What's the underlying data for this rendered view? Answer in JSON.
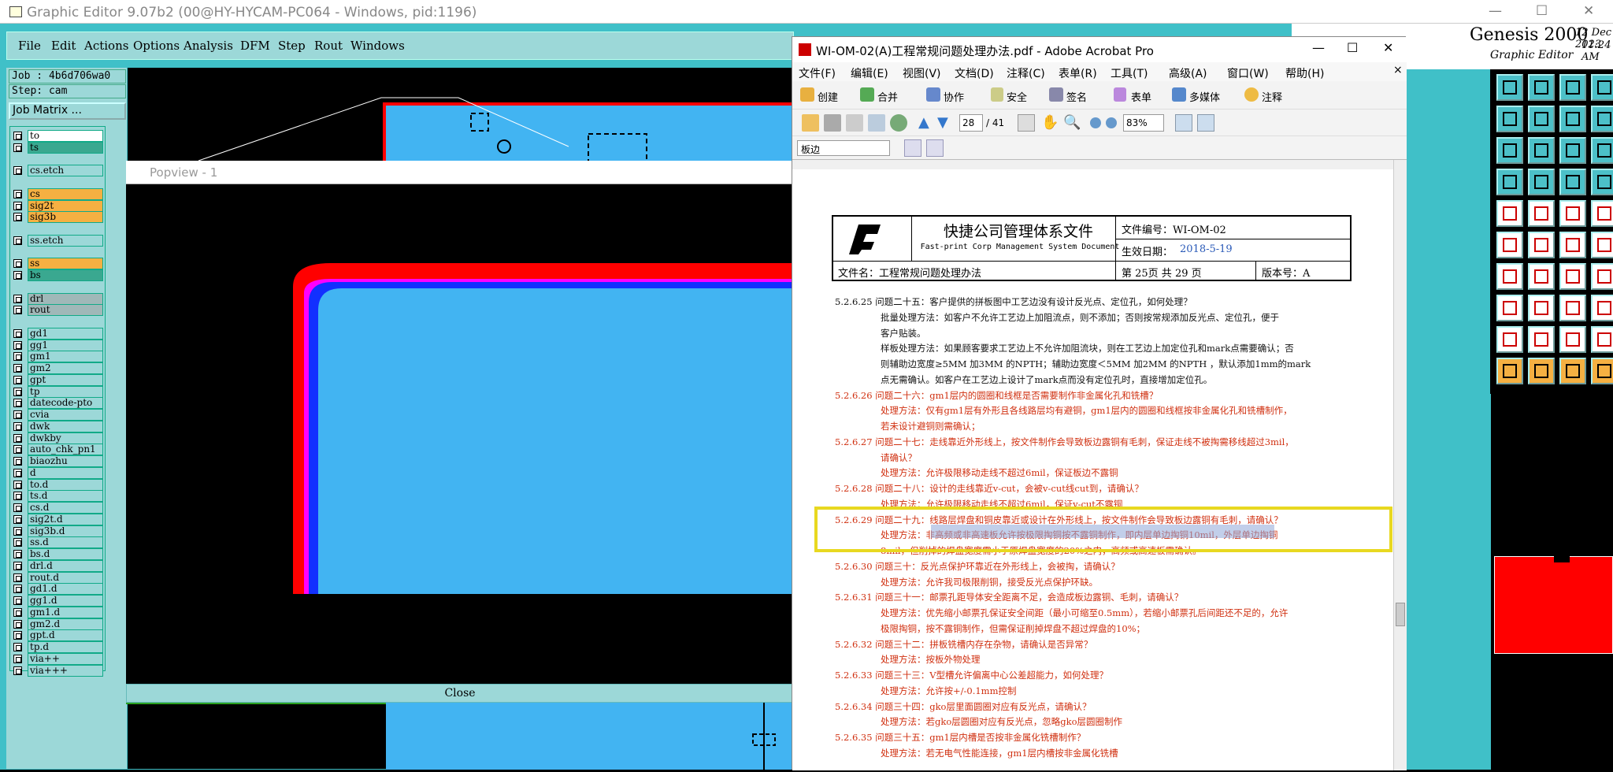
{
  "genesis": {
    "title": "Graphic Editor 9.07b2 (00@HY-HYCAM-PC064 - Windows, pid:1196)",
    "menu": [
      "File",
      "Edit",
      "Actions",
      "Options",
      "Analysis",
      "DFM",
      "Step",
      "Rout",
      "Windows"
    ],
    "job": "Job : 4b6d706wa0",
    "step": "Step: cam",
    "job_matrix": "Job Matrix ...",
    "layers": [
      {
        "n": "to",
        "c": "#ffffff"
      },
      {
        "n": "ts",
        "c": "#3aa890"
      },
      {
        "n": "",
        "c": ""
      },
      {
        "n": "cs.etch",
        "c": "#9cd8d8"
      },
      {
        "n": "",
        "c": ""
      },
      {
        "n": "cs",
        "c": "#f5b042"
      },
      {
        "n": "sig2t",
        "c": "#f5b042"
      },
      {
        "n": "sig3b",
        "c": "#f5b042"
      },
      {
        "n": "",
        "c": ""
      },
      {
        "n": "ss.etch",
        "c": "#9cd8d8"
      },
      {
        "n": "",
        "c": ""
      },
      {
        "n": "ss",
        "c": "#f5b042"
      },
      {
        "n": "bs",
        "c": "#3aa890"
      },
      {
        "n": "",
        "c": ""
      },
      {
        "n": "drl",
        "c": "#a0b8b8"
      },
      {
        "n": "rout",
        "c": "#a0b8b8"
      },
      {
        "n": "",
        "c": ""
      },
      {
        "n": "gd1",
        "c": "#9cd8d8"
      },
      {
        "n": "gg1",
        "c": "#9cd8d8"
      },
      {
        "n": "gm1",
        "c": "#9cd8d8"
      },
      {
        "n": "gm2",
        "c": "#9cd8d8"
      },
      {
        "n": "gpt",
        "c": "#9cd8d8"
      },
      {
        "n": "tp",
        "c": "#9cd8d8"
      },
      {
        "n": "datecode-pto",
        "c": "#9cd8d8"
      },
      {
        "n": "cvia",
        "c": "#9cd8d8"
      },
      {
        "n": "dwk",
        "c": "#9cd8d8"
      },
      {
        "n": "dwkby",
        "c": "#9cd8d8"
      },
      {
        "n": "auto_chk_pn1",
        "c": "#9cd8d8"
      },
      {
        "n": "biaozhu",
        "c": "#9cd8d8"
      },
      {
        "n": "d",
        "c": "#9cd8d8"
      },
      {
        "n": "to.d",
        "c": "#9cd8d8"
      },
      {
        "n": "ts.d",
        "c": "#9cd8d8"
      },
      {
        "n": "cs.d",
        "c": "#9cd8d8"
      },
      {
        "n": "sig2t.d",
        "c": "#9cd8d8"
      },
      {
        "n": "sig3b.d",
        "c": "#9cd8d8"
      },
      {
        "n": "ss.d",
        "c": "#9cd8d8"
      },
      {
        "n": "bs.d",
        "c": "#9cd8d8"
      },
      {
        "n": "drl.d",
        "c": "#9cd8d8"
      },
      {
        "n": "rout.d",
        "c": "#9cd8d8"
      },
      {
        "n": "gd1.d",
        "c": "#9cd8d8"
      },
      {
        "n": "gg1.d",
        "c": "#9cd8d8"
      },
      {
        "n": "gm1.d",
        "c": "#9cd8d8"
      },
      {
        "n": "gm2.d",
        "c": "#9cd8d8"
      },
      {
        "n": "gpt.d",
        "c": "#9cd8d8"
      },
      {
        "n": "tp.d",
        "c": "#9cd8d8"
      },
      {
        "n": "via++",
        "c": "#9cd8d8"
      },
      {
        "n": "via+++",
        "c": "#9cd8d8"
      }
    ],
    "popview_title": "Popview - 1",
    "close": "Close",
    "logo": "Genesis 2000",
    "logo_sub": "Graphic Editor",
    "date": "12 Dec 2023",
    "time": "11:24 AM"
  },
  "acrobat": {
    "title": "WI-OM-02(A)工程常规问题处理办法.pdf - Adobe Acrobat Pro",
    "menu": [
      "文件(F)",
      "编辑(E)",
      "视图(V)",
      "文档(D)",
      "注释(C)",
      "表单(R)",
      "工具(T)",
      "高级(A)",
      "窗口(W)",
      "帮助(H)"
    ],
    "tools": [
      "创建",
      "合并",
      "协作",
      "安全",
      "签名",
      "表单",
      "多媒体",
      "注释"
    ],
    "page": "28",
    "pages": "/ 41",
    "zoom": "83%",
    "bookmark": "板边",
    "doc": {
      "company": "快捷公司管理体系文件",
      "company_en": "Fast-print Corp Management System Document",
      "docno": "文件编号：WI-OM-02",
      "date_label": "生效日期：",
      "date": "2018-5-19",
      "fname": "文件名：工程常规问题处理办法",
      "page": "第 25页 共 29 页",
      "ver": "版本号：A",
      "lines": [
        {
          "t": "5.2.6.25 问题二十五：客户提供的拼板图中工艺边没有设计反光点、定位孔，如何处理？",
          "c": "blk",
          "x": 0
        },
        {
          "t": "批量处理方法：如客户不允许工艺边上加阻流点，则不添加；否则按常规添加反光点、定位孔，便于",
          "c": "blk",
          "x": 58
        },
        {
          "t": "客户贴装。",
          "c": "blk",
          "x": 58
        },
        {
          "t": "样板处理方法：如果顾客要求工艺边上不允许加阻流块，则在工艺边上加定位孔和mark点需要确认；否",
          "c": "blk",
          "x": 58
        },
        {
          "t": "则辅助边宽度≥5MM 加3MM 的NPTH；辅助边宽度＜5MM 加2MM 的NPTH ，默认添加1mm的mark",
          "c": "blk",
          "x": 58
        },
        {
          "t": "点无需确认。如客户在工艺边上设计了mark点而没有定位孔时，直接增加定位孔。",
          "c": "blk",
          "x": 58
        },
        {
          "t": "5.2.6.26 问题二十六：gm1层内的圆圈和线框是否需要制作非金属化孔和铣槽？",
          "c": "red",
          "x": 0
        },
        {
          "t": "处理方法：仅有gm1层有外形且各线路层均有避铜，gm1层内的圆圈和线框按非金属化孔和铣槽制作，",
          "c": "red",
          "x": 58
        },
        {
          "t": "若未设计避铜则需确认；",
          "c": "red",
          "x": 58
        },
        {
          "t": "5.2.6.27 问题二十七：走线靠近外形线上，按文件制作会导致板边露铜有毛刺，保证走线不被掏需移线超过3mil，",
          "c": "red",
          "x": 0
        },
        {
          "t": "请确认？",
          "c": "red",
          "x": 58
        },
        {
          "t": "处理方法：允许极限移动走线不超过6mil，保证板边不露铜",
          "c": "red",
          "x": 58
        },
        {
          "t": "5.2.6.28 问题二十八：设计的走线靠近v-cut，会被v-cut线cut到，请确认？",
          "c": "red",
          "x": 0
        },
        {
          "t": "处理方法：允许极限移动走线不超过6mil，保证v-cut不露铜",
          "c": "red",
          "x": 58
        },
        {
          "t": "5.2.6.29 问题二十九：线路层焊盘和铜皮靠近或设计在外形线上，按文件制作会导致板边露铜有毛刺，请确认？",
          "c": "red",
          "x": 0
        },
        {
          "t": "处理方法：非高频或非高速板允许按极限掏铜按不露铜制作，即内层单边掏铜10mil，外层单边掏铜",
          "c": "red",
          "x": 58
        },
        {
          "t": "8mil，但削掉的焊盘宽度需小于原焊盘宽度的20%之内，高频或高速板需确认。",
          "c": "red",
          "x": 58
        },
        {
          "t": "5.2.6.30 问题三十：反光点保护环靠近在外形线上，会被掏，请确认？",
          "c": "red",
          "x": 0
        },
        {
          "t": "处理方法：允许我司极限削铜，接受反光点保护环缺。",
          "c": "red",
          "x": 58
        },
        {
          "t": "5.2.6.31 问题三十一：邮票孔距导体安全距离不足，会造成板边露铜、毛刺，请确认？",
          "c": "red",
          "x": 0
        },
        {
          "t": "处理方法：优先缩小邮票孔保证安全间距（最小可缩至0.5mm），若缩小邮票孔后间距还不足的，允许",
          "c": "red",
          "x": 58
        },
        {
          "t": "极限掏铜，按不露铜制作，但需保证削掉焊盘不超过焊盘的10%；",
          "c": "red",
          "x": 58
        },
        {
          "t": "5.2.6.32 问题三十二：拼板铣槽内存在杂物，请确认是否异常？",
          "c": "red",
          "x": 0
        },
        {
          "t": "处理方法：按板外物处理",
          "c": "red",
          "x": 58
        },
        {
          "t": "5.2.6.33 问题三十三：V型槽允许偏离中心公差超能力，如何处理？",
          "c": "red",
          "x": 0
        },
        {
          "t": "处理方法：允许按+/-0.1mm控制",
          "c": "red",
          "x": 58
        },
        {
          "t": "5.2.6.34 问题三十四：gko层里面圆圈对应有反光点，请确认？",
          "c": "red",
          "x": 0
        },
        {
          "t": "处理方法：若gko层圆圈对应有反光点，忽略gko层圆圈制作",
          "c": "red",
          "x": 58
        },
        {
          "t": "5.2.6.35 问题三十五：gm1层内槽是否按非金属化铣槽制作？",
          "c": "red",
          "x": 0
        },
        {
          "t": "处理方法：若无电气性能连接，gm1层内槽按非金属化铣槽",
          "c": "red",
          "x": 58
        }
      ]
    }
  }
}
